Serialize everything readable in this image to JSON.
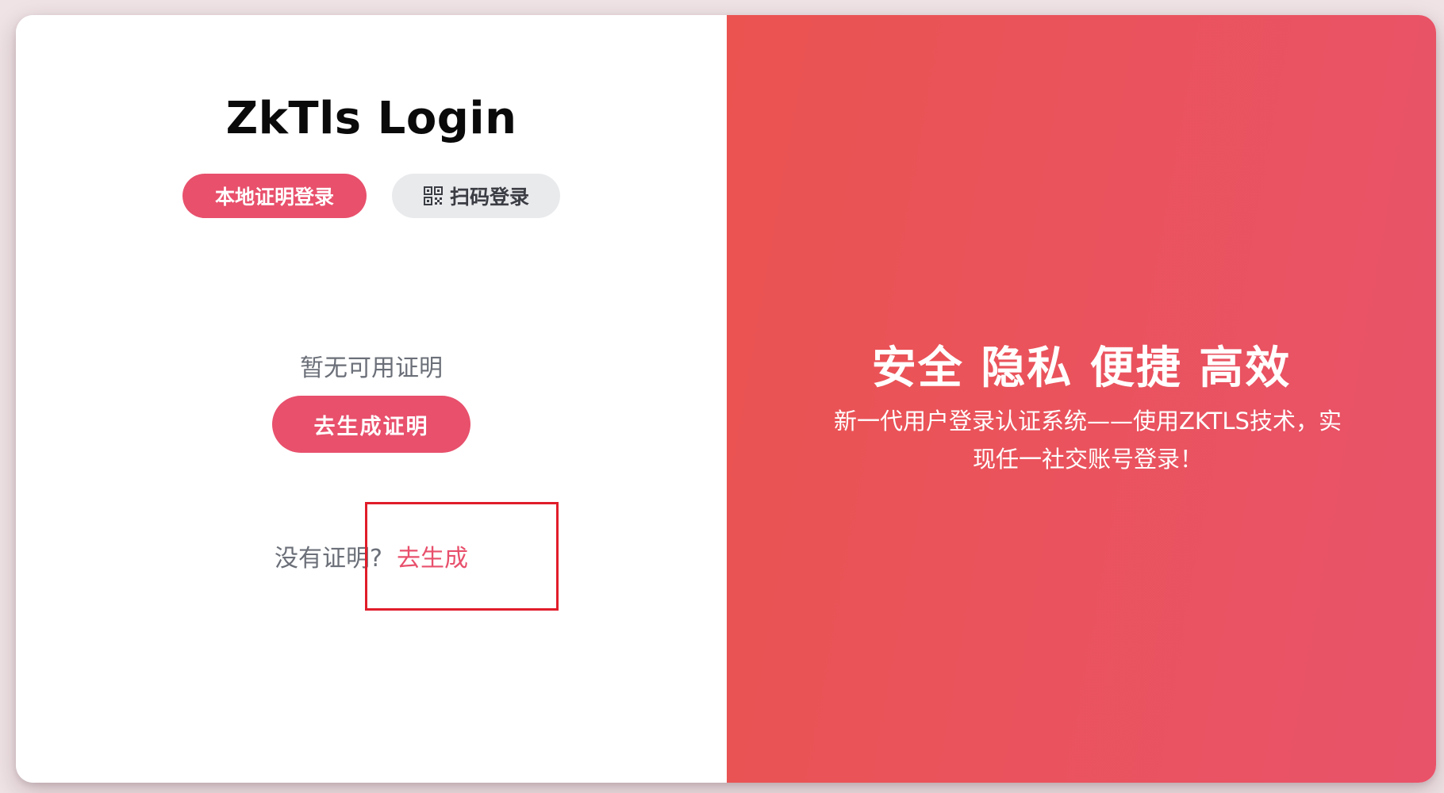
{
  "login": {
    "title": "ZkTls Login",
    "tabs": {
      "local": "本地证明登录",
      "scan": "扫码登录"
    },
    "empty_message": "暂无可用证明",
    "generate_button": "去生成证明",
    "footer": {
      "question": "没有证明?",
      "link": "去生成"
    }
  },
  "promo": {
    "slogan": "安全 隐私 便捷 高效",
    "description": "新一代用户登录认证系统——使用ZKTLS技术，实现任一社交账号登录！"
  },
  "icons": {
    "scan_tab": "qr-code-icon"
  },
  "colors": {
    "accent": "#e8506c",
    "gradient_start": "#ea5350",
    "gradient_end": "#e9536a",
    "highlight_box": "#e11d2a"
  }
}
